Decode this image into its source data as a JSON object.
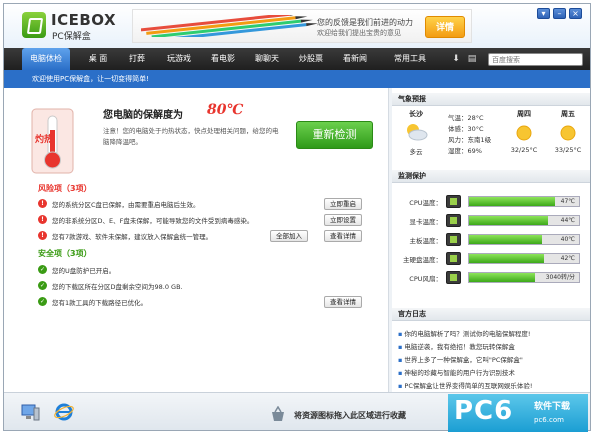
{
  "app": {
    "logo_title": "ICEBOX",
    "logo_subtitle": "PC保解盒"
  },
  "banner": {
    "line1": "您的反馈是我们前进的动力",
    "line2": "欢迎给我们提出宝贵的意见",
    "detail_label": "详情"
  },
  "window_controls": [
    "▾",
    "–",
    "×"
  ],
  "nav": {
    "items": [
      "电脑体检",
      "桌 面",
      "打葬",
      "玩游戏",
      "看电影",
      "聊聊天",
      "炒股票",
      "看新闻",
      "常用工具"
    ],
    "active_index": 0,
    "search_placeholder": "百度搜索"
  },
  "welcome": "欢迎使用PC保解盒，让一切变得简单!",
  "health": {
    "badge": "灼热",
    "title": "您电脑的保解度为",
    "temp": "80℃",
    "desc": "注意！您的电脑处于灼热状态，快点处理相关问题，给您的电脑降降温吧。",
    "recheck_label": "重新检测"
  },
  "risk": {
    "title": "风险项（3项）",
    "items": [
      {
        "text": "您的系统分区C盘已保解，由需要重启电脑后生效。",
        "actions": [
          "立即重启"
        ]
      },
      {
        "text": "您的非系统分区D、E、F盘未保解，可能导致您的文件受到病毒感染。",
        "actions": [
          "立即设置"
        ]
      },
      {
        "text": "您有7款游戏、软件未保解，建议放入保解盒统一管理。",
        "actions": [
          "全部加入",
          "查看详情"
        ]
      }
    ]
  },
  "safe": {
    "title": "安全项（3项）",
    "items": [
      {
        "text": "您的U盘防护已开启。",
        "actions": []
      },
      {
        "text": "您的下载区所在分区D盘剩余空间为98.0 GB.",
        "actions": []
      },
      {
        "text": "您有1款工具的下载路径已优化。",
        "actions": [
          "查看详情"
        ]
      }
    ]
  },
  "weather": {
    "title": "气象预报",
    "city": "长沙",
    "today_cond": "多云",
    "temp": "气温：28°C",
    "feel": "体感：30°C",
    "wind": "风力：东南1级",
    "humidity": "湿度：69%",
    "days": [
      {
        "day": "周四",
        "range": "32/25°C"
      },
      {
        "day": "周五",
        "range": "33/25°C"
      }
    ]
  },
  "monitor": {
    "title": "监测保护",
    "rows": [
      {
        "label": "CPU温度：",
        "value": "47℃",
        "fill": 0.78
      },
      {
        "label": "显卡温度：",
        "value": "44℃",
        "fill": 0.72
      },
      {
        "label": "主板温度：",
        "value": "40℃",
        "fill": 0.66
      },
      {
        "label": "主硬盘温度：",
        "value": "42℃",
        "fill": 0.68
      },
      {
        "label": "CPU风扇：",
        "value": "3040转/分",
        "fill": 0.6
      }
    ]
  },
  "log": {
    "title": "官方日志",
    "items": [
      "你的电脑解析了吗？测试你的电脑保解程度!",
      "电脑逆袭，我有绝招！教您玩转保解盒",
      "世界上多了一种保解盒，它叫\"PC保解盒\"",
      "神秘的珍藏与智能的用户行为识别技术",
      "PC保解盒让世界变得简单的互联网娱乐体验!"
    ]
  },
  "footer": {
    "drop_text": "将资源图标拖入此区域进行收藏"
  },
  "watermark": {
    "big": "PC6",
    "small": "软件下载",
    "url": "pc6.com"
  },
  "colors": {
    "nav_bg": "#2a2a2a",
    "accent_blue": "#2b6fc8",
    "risk_red": "#e8352e",
    "safe_green": "#3a9b14"
  }
}
